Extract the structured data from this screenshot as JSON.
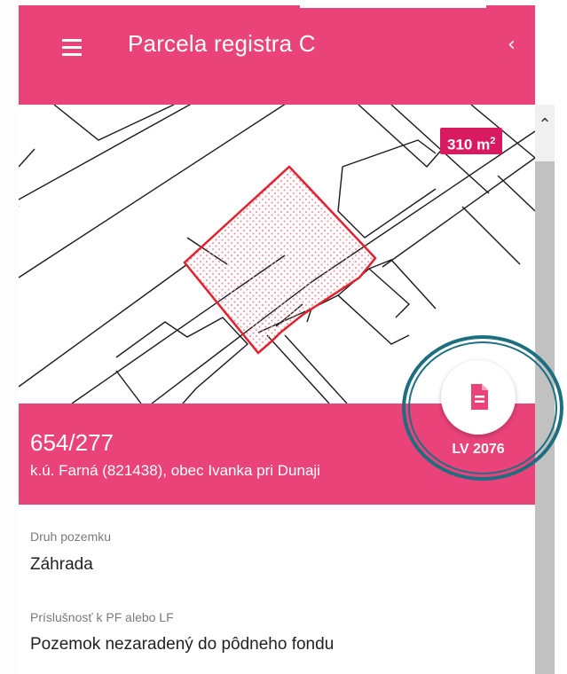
{
  "header": {
    "title": "Parcela registra C",
    "menu_icon": "hamburger-menu-icon",
    "collapse_icon": "chevron-left-icon",
    "collapse_glyph": "‹"
  },
  "map": {
    "area_value": "310 m",
    "area_unit_exponent": "2",
    "scroll_up_glyph": "⌃"
  },
  "parcel": {
    "number": "654/277",
    "location": "k.ú. Farná (821438), obec Ivanka pri Dunaji",
    "document_icon": "document-icon",
    "lv_label": "LV 2076"
  },
  "details": [
    {
      "label": "Druh pozemku",
      "value": "Záhrada"
    },
    {
      "label": "Príslušnosť k PF alebo LF",
      "value": "Pozemok nezaradený do pôdneho fondu"
    }
  ],
  "colors": {
    "brand": "#ea4379",
    "badge": "#d81b60",
    "parcel_outline": "#e4202e",
    "highlight_ring": "#1c6f81"
  }
}
